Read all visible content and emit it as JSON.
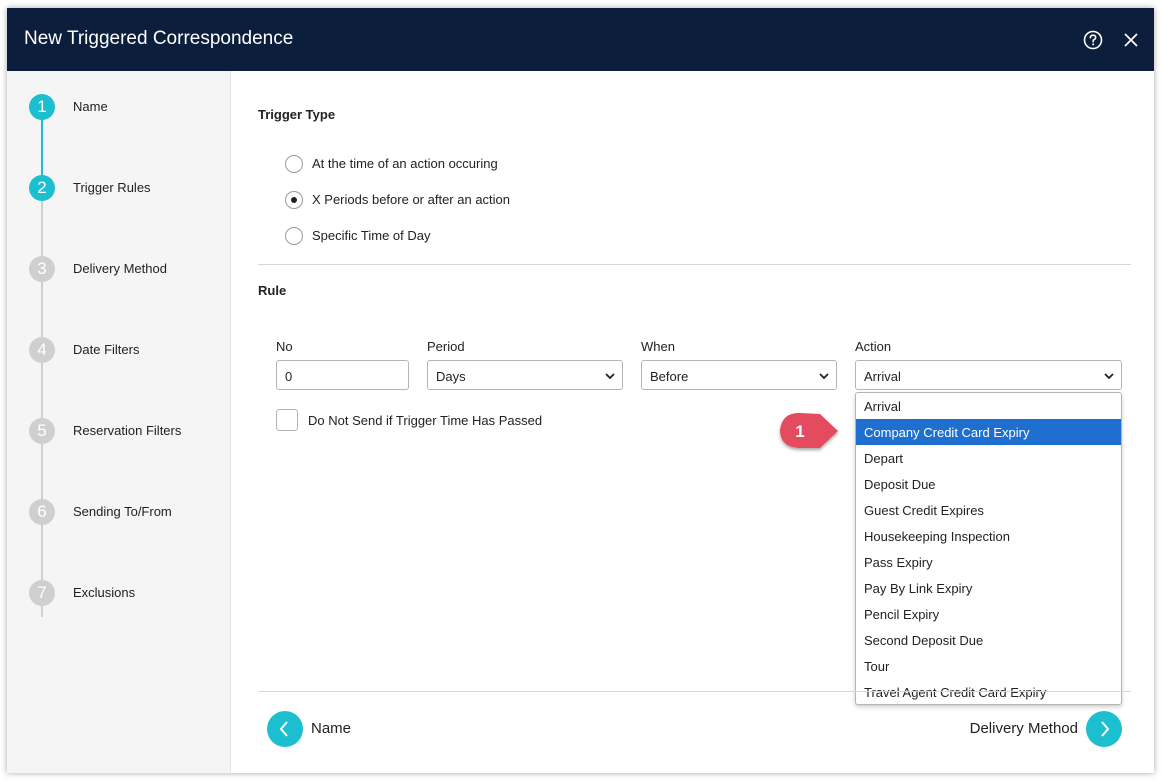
{
  "dialog": {
    "title": "New Triggered Correspondence",
    "help_icon": "help-circle-icon",
    "close_icon": "close-icon"
  },
  "colors": {
    "header_bg": "#0b1e3b",
    "accent": "#1cbfcf",
    "selected_option": "#1e6fd0",
    "callout": "#e44b5e"
  },
  "steps": [
    {
      "number": "1",
      "label": "Name",
      "state": "done"
    },
    {
      "number": "2",
      "label": "Trigger Rules",
      "state": "current"
    },
    {
      "number": "3",
      "label": "Delivery Method",
      "state": "todo"
    },
    {
      "number": "4",
      "label": "Date Filters",
      "state": "todo"
    },
    {
      "number": "5",
      "label": "Reservation Filters",
      "state": "todo"
    },
    {
      "number": "6",
      "label": "Sending To/From",
      "state": "todo"
    },
    {
      "number": "7",
      "label": "Exclusions",
      "state": "todo"
    }
  ],
  "trigger_type": {
    "title": "Trigger Type",
    "options": [
      {
        "label": "At the time of an action occuring",
        "checked": false
      },
      {
        "label": "X Periods before or after an action",
        "checked": true
      },
      {
        "label": "Specific Time of Day",
        "checked": false
      }
    ]
  },
  "rule": {
    "title": "Rule",
    "no": {
      "label": "No",
      "value": "0"
    },
    "period": {
      "label": "Period",
      "value": "Days"
    },
    "when": {
      "label": "When",
      "value": "Before"
    },
    "action": {
      "label": "Action",
      "value": "Arrival"
    },
    "checkbox_label": "Do Not Send if Trigger Time Has Passed",
    "checkbox_checked": false
  },
  "action_dropdown": {
    "selected_index": 1,
    "options": [
      "Arrival",
      "Company Credit Card Expiry",
      "Depart",
      "Deposit Due",
      "Guest Credit Expires",
      "Housekeeping Inspection",
      "Pass Expiry",
      "Pay By Link Expiry",
      "Pencil Expiry",
      "Second Deposit Due",
      "Tour",
      "Travel Agent Credit Card Expiry"
    ]
  },
  "callout": {
    "number": "1"
  },
  "footer": {
    "back_label": "Name",
    "next_label": "Delivery Method",
    "back_icon": "chevron-left-icon",
    "next_icon": "chevron-right-icon"
  }
}
